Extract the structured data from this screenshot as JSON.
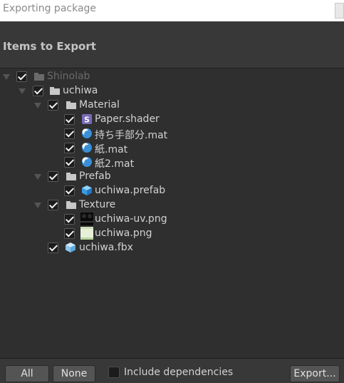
{
  "window": {
    "title": "Exporting package"
  },
  "header": {
    "title": "Items to Export"
  },
  "tree": [
    {
      "label": "Shinolab",
      "type": "folder",
      "dim": true
    },
    {
      "label": "uchiwa",
      "type": "folder"
    },
    {
      "label": "Material",
      "type": "folder"
    },
    {
      "label": "Paper.shader",
      "type": "shader"
    },
    {
      "label": "持ち手部分.mat",
      "type": "material"
    },
    {
      "label": "紙.mat",
      "type": "material"
    },
    {
      "label": "紙2.mat",
      "type": "material"
    },
    {
      "label": "Prefab",
      "type": "folder"
    },
    {
      "label": "uchiwa.prefab",
      "type": "prefab"
    },
    {
      "label": "Texture",
      "type": "folder"
    },
    {
      "label": "uchiwa-uv.png",
      "type": "texture-dark"
    },
    {
      "label": "uchiwa.png",
      "type": "texture-light"
    },
    {
      "label": "uchiwa.fbx",
      "type": "model"
    }
  ],
  "footer": {
    "all_label": "All",
    "none_label": "None",
    "include_dependencies_label": "Include dependencies",
    "include_dependencies_checked": false,
    "export_label": "Export..."
  },
  "icons": {
    "shader": "shader-icon",
    "material": "material-icon",
    "prefab": "prefab-icon",
    "texture": "texture-icon",
    "model": "model-icon",
    "folder": "folder-icon"
  }
}
